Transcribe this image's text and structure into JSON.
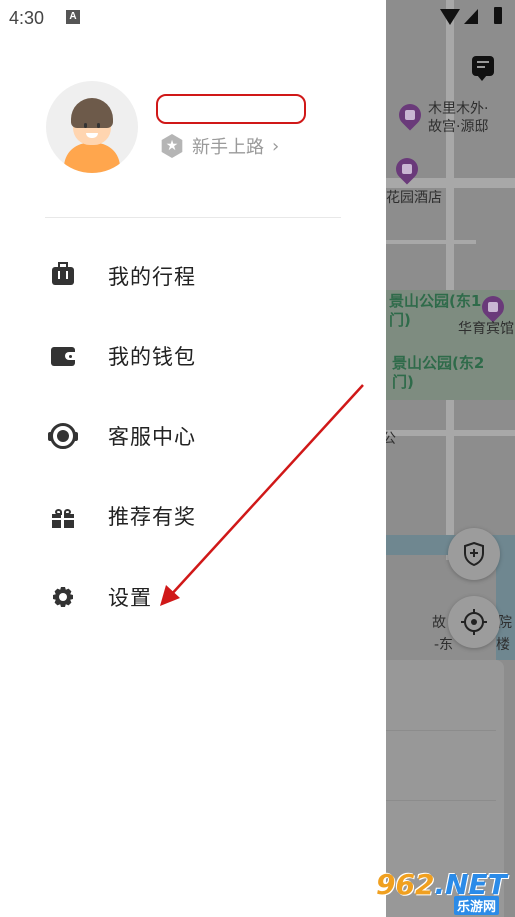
{
  "status_bar": {
    "time": "4:30",
    "notification_icon": "A"
  },
  "drawer": {
    "avatar": "avatar",
    "user_level": "新手上路",
    "level_chevron": "›",
    "menu": [
      {
        "label": "我的行程",
        "icon": "luggage-icon"
      },
      {
        "label": "我的钱包",
        "icon": "wallet-icon"
      },
      {
        "label": "客服中心",
        "icon": "headset-icon"
      },
      {
        "label": "推荐有奖",
        "icon": "gift-icon"
      },
      {
        "label": "设置",
        "icon": "gear-icon"
      }
    ]
  },
  "map": {
    "labels": {
      "poi1_line1": "木里木外·",
      "poi1_line2": "故宫·源邸",
      "poi2": "花园酒店",
      "park1_line1": "景山公园(东1",
      "park1_line2": "门)",
      "poi3": "华育宾馆",
      "park2_line1": "景山公园(东2",
      "park2_line2": "门)",
      "poi4_line1": "故",
      "poi4_line2": "院",
      "poi4_line3": "-东",
      "poi4_line4": "楼",
      "side_char": "公"
    }
  },
  "watermark": {
    "logo_left": "962",
    "logo_right": ".NET",
    "sub": "乐游网"
  },
  "colors": {
    "accent_red": "#d01818",
    "overlay_grey": "#8a8a8a",
    "text_primary": "#222222",
    "text_secondary": "#9a9a9a"
  }
}
